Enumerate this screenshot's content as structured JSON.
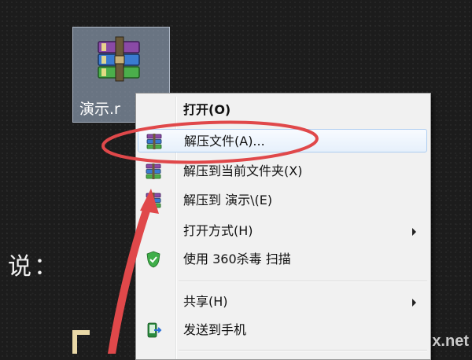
{
  "desktop": {
    "icon_label": "演示.r",
    "side_text": "说："
  },
  "context_menu": {
    "items": [
      {
        "label": "打开(O)",
        "icon": "none"
      },
      {
        "label": "解压文件(A)...",
        "icon": "winrar-books-icon"
      },
      {
        "label": "解压到当前文件夹(X)",
        "icon": "winrar-books-icon"
      },
      {
        "label": "解压到 演示\\(E)",
        "icon": "winrar-books-icon"
      },
      {
        "label": "打开方式(H)",
        "icon": "none",
        "submenu": true
      },
      {
        "label": "使用 360杀毒 扫描",
        "icon": "360-shield-icon"
      },
      {
        "label": "共享(H)",
        "icon": "none",
        "submenu": true
      },
      {
        "label": "发送到手机",
        "icon": "send-to-phone-icon"
      }
    ]
  },
  "annotation": {
    "color": "#e0484a",
    "highlighted_item": "解压文件(A)..."
  },
  "watermark": "x.net",
  "colors": {
    "menu_background": "#f1f1f1",
    "hover_border": "#aecdf0",
    "selection_fill": "#aabed7"
  }
}
